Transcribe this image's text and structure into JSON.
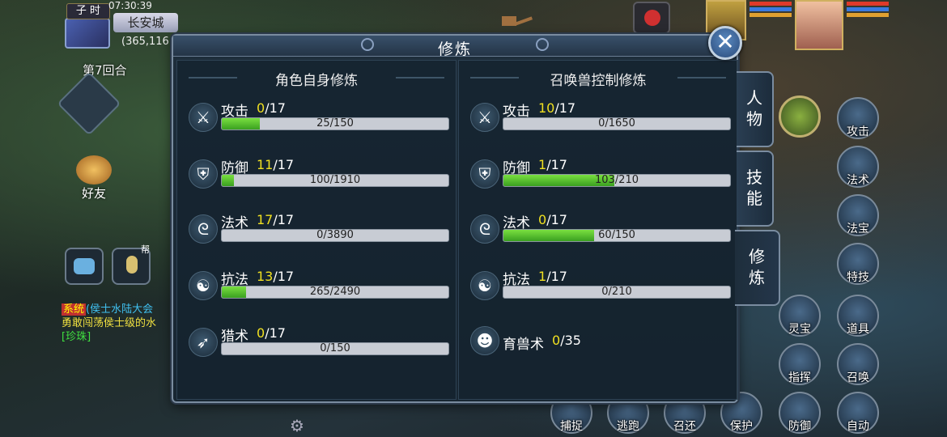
{
  "hud": {
    "shichen": "子 时",
    "clock": "07:30:39",
    "city": "长安城",
    "coords": "(365,116",
    "round": "第7回合",
    "friends_label": "好友",
    "voice_tag": "帮",
    "chat": {
      "sys_tag": "系统",
      "line1": "(侯士水陆大会",
      "line2": "勇敢闯荡侯士级的水",
      "line3": "[珍珠]"
    }
  },
  "panel": {
    "title": "修炼",
    "close_icon": "close-icon",
    "left": {
      "heading": "角色自身修炼",
      "rows": [
        {
          "icon": "sword-icon",
          "glyph": "⚔",
          "name": "攻击",
          "level": "0",
          "max": "/17",
          "progress": "25/150",
          "fill_pct": 16.7
        },
        {
          "icon": "shield-icon",
          "glyph": "⛨",
          "name": "防御",
          "level": "11",
          "max": "/17",
          "progress": "100/1910",
          "fill_pct": 5.2
        },
        {
          "icon": "staff-icon",
          "glyph": "ᘓ",
          "name": "法术",
          "level": "17",
          "max": "/17",
          "progress": "0/3890",
          "fill_pct": 0
        },
        {
          "icon": "yinyang-icon",
          "glyph": "☯",
          "name": "抗法",
          "level": "13",
          "max": "/17",
          "progress": "265/2490",
          "fill_pct": 10.6
        },
        {
          "icon": "bow-icon",
          "glyph": "➶",
          "name": "猎术",
          "level": "0",
          "max": "/17",
          "progress": "0/150",
          "fill_pct": 0
        }
      ]
    },
    "right": {
      "heading": "召唤兽控制修炼",
      "rows": [
        {
          "icon": "sword-icon",
          "glyph": "⚔",
          "name": "攻击",
          "level": "10",
          "max": "/17",
          "progress": "0/1650",
          "fill_pct": 0
        },
        {
          "icon": "shield-icon",
          "glyph": "⛨",
          "name": "防御",
          "level": "1",
          "max": "/17",
          "progress": "103/210",
          "fill_pct": 49
        },
        {
          "icon": "staff-icon",
          "glyph": "ᘓ",
          "name": "法术",
          "level": "0",
          "max": "/17",
          "progress": "60/150",
          "fill_pct": 40
        },
        {
          "icon": "yinyang-icon",
          "glyph": "☯",
          "name": "抗法",
          "level": "1",
          "max": "/17",
          "progress": "0/210",
          "fill_pct": 0
        },
        {
          "icon": "panda-icon",
          "glyph": "☻",
          "name": "育兽术",
          "level": "0",
          "max": "/35",
          "progress": null,
          "fill_pct": null
        }
      ]
    }
  },
  "tabs": [
    {
      "label": "人物",
      "active": false
    },
    {
      "label": "技能",
      "active": false
    },
    {
      "label": "修炼",
      "active": true
    }
  ],
  "commands": {
    "attack": "攻击",
    "magic": "法术",
    "treasure": "法宝",
    "special": "特技",
    "spirit": "灵宝",
    "item": "道具",
    "command": "指挥",
    "summon": "召唤",
    "capture": "捕捉",
    "flee": "逃跑",
    "recall": "召还",
    "protect": "保护",
    "defend": "防御",
    "auto": "自动"
  }
}
